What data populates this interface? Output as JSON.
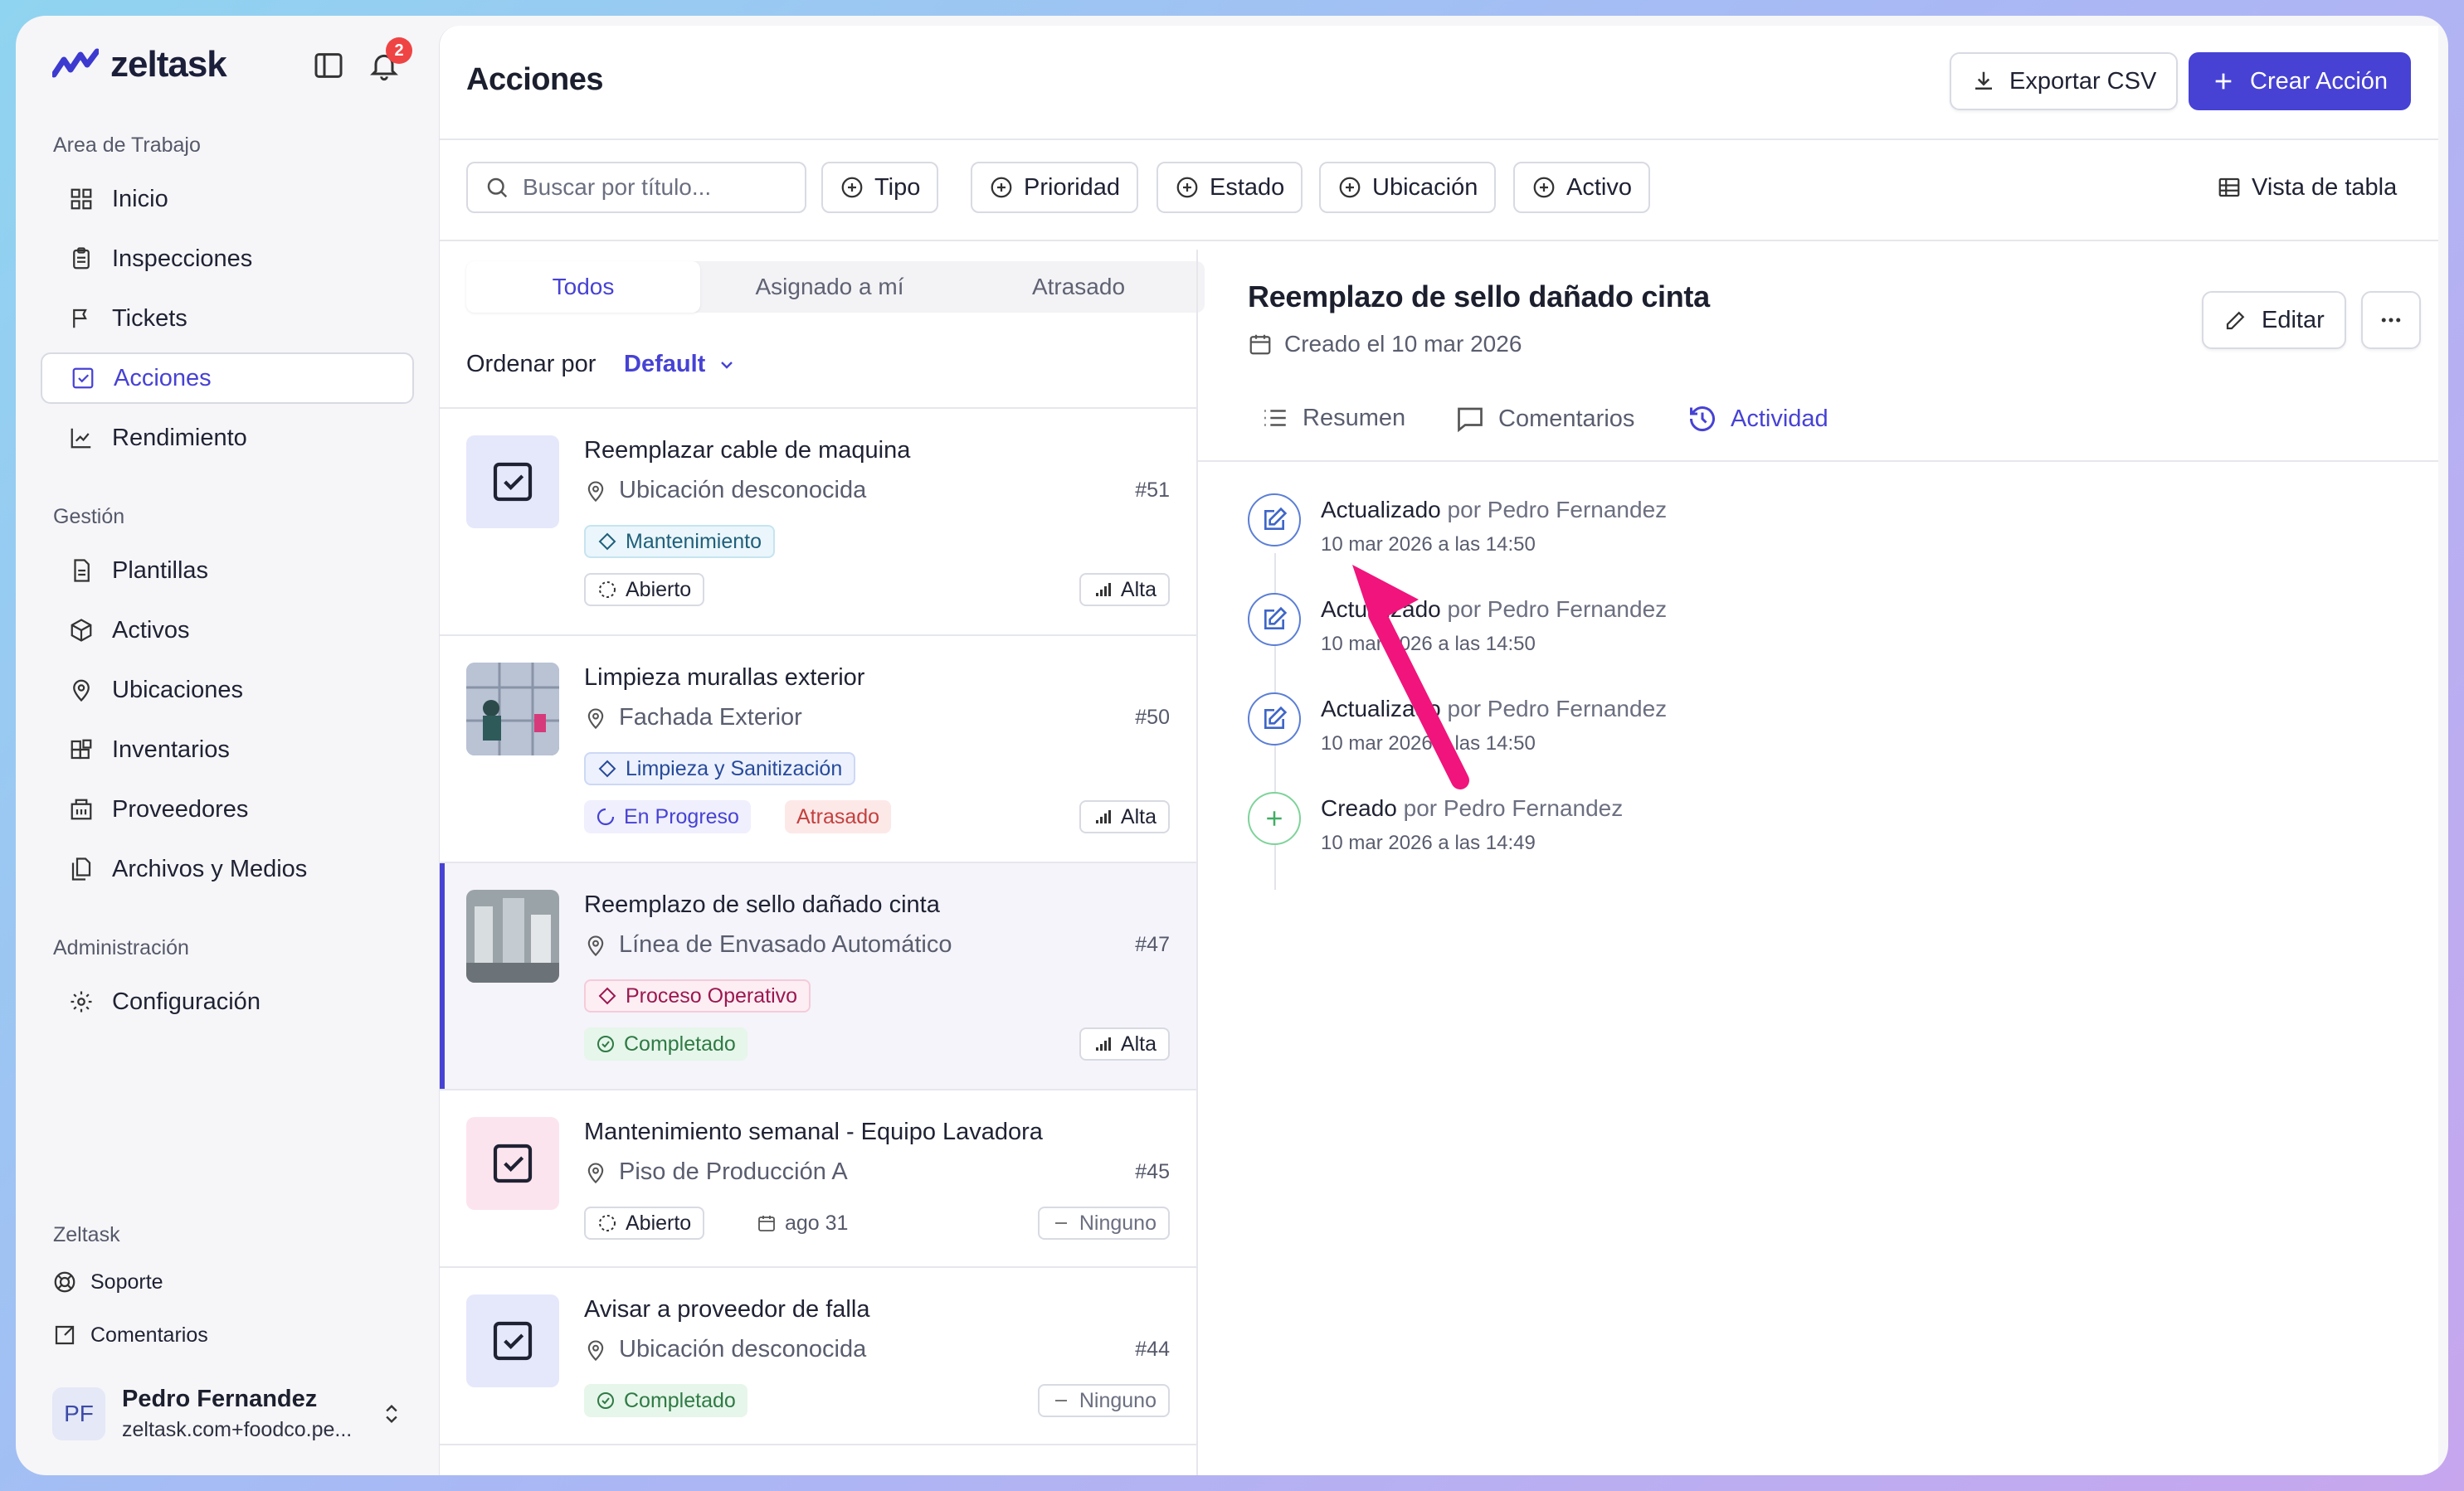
{
  "brand": {
    "name": "zeltask"
  },
  "notifications": {
    "count": "2"
  },
  "sidebar": {
    "sections": [
      {
        "label": "Area de Trabajo",
        "items": [
          {
            "label": "Inicio",
            "icon": "grid-icon"
          },
          {
            "label": "Inspecciones",
            "icon": "clipboard-icon"
          },
          {
            "label": "Tickets",
            "icon": "flag-icon"
          },
          {
            "label": "Acciones",
            "icon": "check-square-icon",
            "active": true
          },
          {
            "label": "Rendimiento",
            "icon": "chart-line-icon"
          }
        ]
      },
      {
        "label": "Gestión",
        "items": [
          {
            "label": "Plantillas",
            "icon": "file-icon"
          },
          {
            "label": "Activos",
            "icon": "box-icon"
          },
          {
            "label": "Ubicaciones",
            "icon": "map-pin-icon"
          },
          {
            "label": "Inventarios",
            "icon": "blocks-icon"
          },
          {
            "label": "Proveedores",
            "icon": "building-icon"
          },
          {
            "label": "Archivos y Medios",
            "icon": "files-icon"
          }
        ]
      },
      {
        "label": "Administración",
        "items": [
          {
            "label": "Configuración",
            "icon": "gear-icon"
          }
        ]
      }
    ],
    "footer_label": "Zeltask",
    "footer_items": [
      {
        "label": "Soporte",
        "icon": "lifebuoy-icon"
      },
      {
        "label": "Comentarios",
        "icon": "external-message-icon"
      }
    ],
    "user": {
      "initials": "PF",
      "name": "Pedro Fernandez",
      "email": "zeltask.com+foodco.pe..."
    }
  },
  "header": {
    "title": "Acciones",
    "export_label": "Exportar CSV",
    "create_label": "Crear Acción"
  },
  "filters": {
    "search_placeholder": "Buscar por título...",
    "chips": [
      "Tipo",
      "Prioridad",
      "Estado",
      "Ubicación",
      "Activo"
    ],
    "view_label": "Vista de tabla"
  },
  "list": {
    "tabs": [
      "Todos",
      "Asignado a mí",
      "Atrasado"
    ],
    "sort_label": "Ordenar por",
    "sort_value": "Default",
    "items": [
      {
        "title": "Reemplazar cable de maquina",
        "location": "Ubicación desconocida",
        "number": "#51",
        "tag": "Mantenimiento",
        "status": "Abierto",
        "priority": "Alta"
      },
      {
        "title": "Limpieza murallas exterior",
        "location": "Fachada Exterior",
        "number": "#50",
        "tag": "Limpieza y Sanitización",
        "status": "En Progreso",
        "overdue": "Atrasado",
        "priority": "Alta"
      },
      {
        "title": "Reemplazo de sello dañado cinta",
        "location": "Línea de Envasado Automático",
        "number": "#47",
        "tag": "Proceso Operativo",
        "status": "Completado",
        "priority": "Alta"
      },
      {
        "title": "Mantenimiento semanal - Equipo Lavadora",
        "location": "Piso de Producción A",
        "number": "#45",
        "status": "Abierto",
        "due": "ago 31",
        "priority": "Ninguno"
      },
      {
        "title": "Avisar a proveedor de falla",
        "location": "Ubicación desconocida",
        "number": "#44",
        "status": "Completado",
        "priority": "Ninguno"
      }
    ]
  },
  "detail": {
    "title": "Reemplazo de sello dañado cinta",
    "created": "Creado el 10 mar 2026",
    "edit_label": "Editar",
    "tabs": [
      "Resumen",
      "Comentarios",
      "Actividad"
    ],
    "activity": [
      {
        "action": "Actualizado",
        "by": "por Pedro Fernandez",
        "date": "10 mar 2026 a las 14:50"
      },
      {
        "action": "Actualizado",
        "by": "por Pedro Fernandez",
        "date": "10 mar 2026 a las 14:50"
      },
      {
        "action": "Actualizado",
        "by": "por Pedro Fernandez",
        "date": "10 mar 2026 a las 14:50"
      },
      {
        "action": "Creado",
        "by": "por Pedro Fernandez",
        "date": "10 mar 2026 a las 14:49"
      }
    ]
  },
  "colors": {
    "accent": "#4742d4",
    "annotation_arrow": "#f0147c",
    "badge": "#ef4444"
  }
}
